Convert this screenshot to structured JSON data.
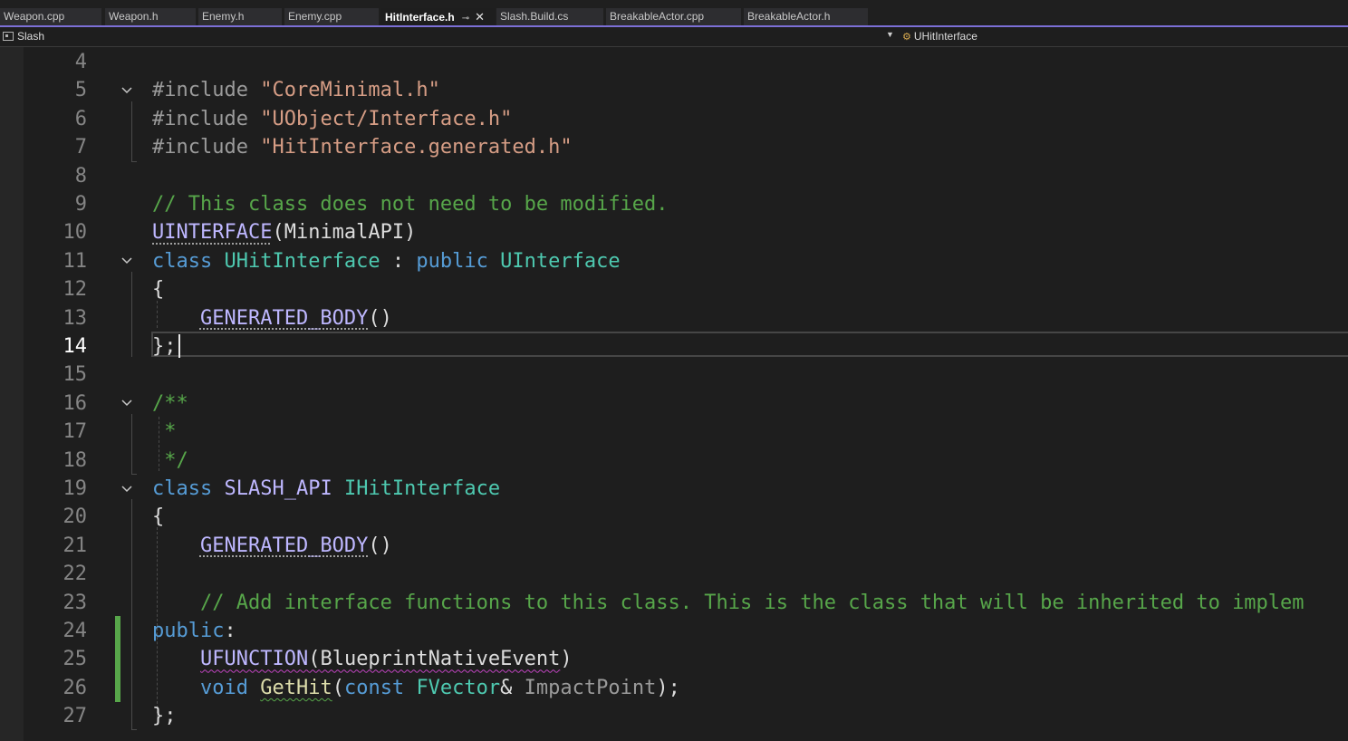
{
  "tabs": [
    {
      "label": "Weapon.cpp",
      "active": false
    },
    {
      "label": "Weapon.h",
      "active": false
    },
    {
      "label": "Enemy.h",
      "active": false
    },
    {
      "label": "Enemy.cpp",
      "active": false
    },
    {
      "label": "HitInterface.h",
      "active": true
    },
    {
      "label": "Slash.Build.cs",
      "active": false
    },
    {
      "label": "BreakableActor.cpp",
      "active": false
    },
    {
      "label": "BreakableActor.h",
      "active": false
    }
  ],
  "tab_pin_glyph": "⊸",
  "tab_close_glyph": "✕",
  "navbar": {
    "project": "Slash",
    "member": "UHitInterface"
  },
  "editor": {
    "current_line": 14,
    "line_numbers": [
      "4",
      "5",
      "6",
      "7",
      "8",
      "9",
      "10",
      "11",
      "12",
      "13",
      "14",
      "15",
      "16",
      "17",
      "18",
      "19",
      "20",
      "21",
      "22",
      "23",
      "24",
      "25",
      "26",
      "27"
    ],
    "code": {
      "l5_kw": "#include",
      "l5_str": "\"CoreMinimal.h\"",
      "l6_kw": "#include",
      "l6_str": "\"UObject/Interface.h\"",
      "l7_kw": "#include",
      "l7_str": "\"HitInterface.generated.h\"",
      "l9_comment": "// This class does not need to be modified.",
      "l10_macro": "UINTERFACE",
      "l10_open": "(",
      "l10_arg": "MinimalAPI",
      "l10_close": ")",
      "l11_kw": "class",
      "l11_name": "UHitInterface",
      "l11_colon": " : ",
      "l11_access": "public",
      "l11_base": "UInterface",
      "brace_open": "{",
      "brace_close": "};",
      "generated_body": "GENERATED_BODY",
      "parens": "()",
      "l16_comment": "/**",
      "l17_comment": " *",
      "l18_comment": " */",
      "l19_kw": "class",
      "l19_api": "SLASH_API",
      "l19_name": "IHitInterface",
      "l23_comment": "// Add interface functions to this class. This is the class that will be inherited to implem",
      "l24_access": "public",
      "l24_colon": ":",
      "l25_macro": "UFUNCTION",
      "l25_open": "(",
      "l25_arg": "BlueprintNativeEvent",
      "l25_close": ")",
      "l26_void": "void",
      "l26_fn": "GetHit",
      "l26_open": "(",
      "l26_const": "const",
      "l26_type": "FVector",
      "l26_amp": "&",
      "l26_param": "ImpactPoint",
      "l26_close": ");"
    }
  },
  "colors": {
    "keyword": "#569cd6",
    "string": "#d69d85",
    "comment": "#57a64a",
    "macro": "#beb7ff",
    "type": "#4ec9b0",
    "function": "#dcdcaa",
    "accent": "#7c6fd6",
    "change_bar": "#57a64a"
  }
}
